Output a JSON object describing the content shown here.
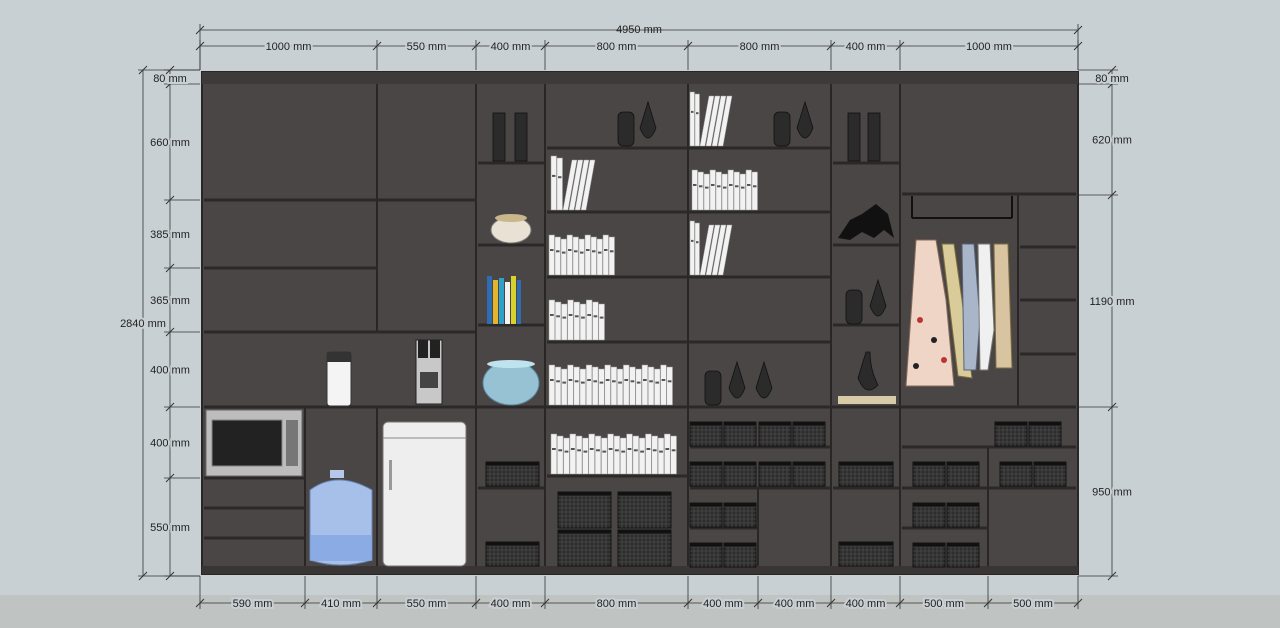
{
  "drawing": {
    "total_width_label": "4950 mm",
    "top_dimensions": [
      "1000 mm",
      "550 mm",
      "400 mm",
      "800 mm",
      "800 mm",
      "400 mm",
      "1000 mm"
    ],
    "bottom_dimensions": [
      "590 mm",
      "410 mm",
      "550 mm",
      "400 mm",
      "800 mm",
      "400 mm",
      "400 mm",
      "400 mm",
      "500 mm",
      "500 mm"
    ],
    "left_dimensions": [
      "80 mm",
      "660 mm",
      "385 mm",
      "365 mm",
      "400 mm",
      "400 mm",
      "550 mm"
    ],
    "left_total_label": "2840 mm",
    "right_dimensions": [
      "80 mm",
      "620 mm",
      "1190 mm",
      "950 mm"
    ]
  },
  "colors": {
    "background": "#c9d0d4",
    "cabinet": "#4b4646",
    "floor": "#bfc3c1"
  },
  "icons": [
    "microwave-icon",
    "water-jug-icon",
    "refrigerator-icon",
    "coffee-machine-icon",
    "kettle-icon",
    "basket-icon",
    "book-row-icon",
    "vase-icon",
    "horse-sculpture-icon",
    "clothes-hanger-icon",
    "fishbowl-icon",
    "dress-icon"
  ]
}
